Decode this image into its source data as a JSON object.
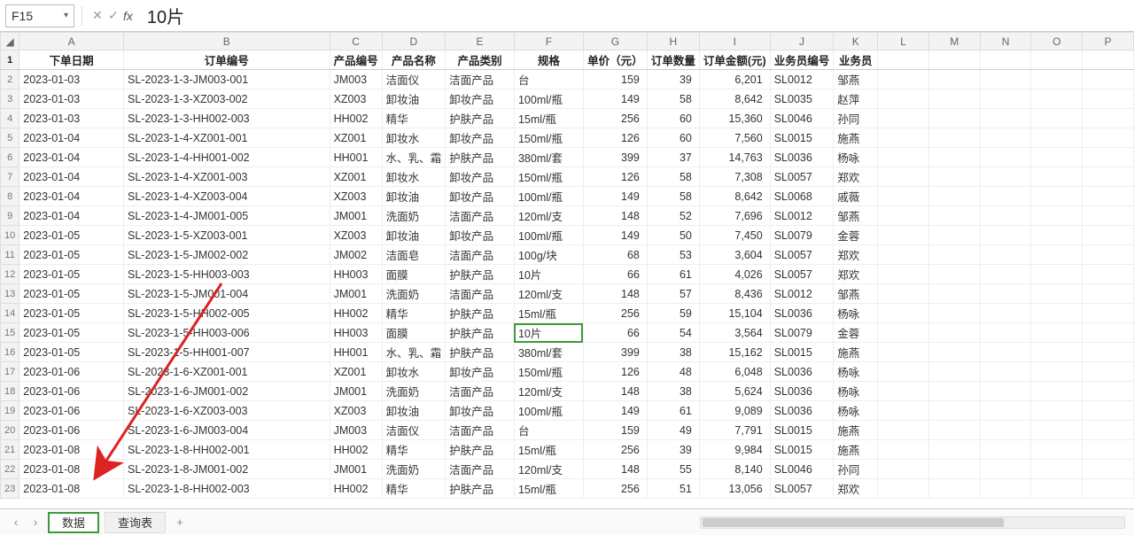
{
  "active_cell_ref": "F15",
  "formula_value": "10片",
  "col_letters": [
    "A",
    "B",
    "C",
    "D",
    "E",
    "F",
    "G",
    "H",
    "I",
    "J",
    "K",
    "L",
    "M",
    "N",
    "O",
    "P"
  ],
  "headers": {
    "c1": "下单日期",
    "c2": "订单编号",
    "c3": "产品编号",
    "c4": "产品名称",
    "c5": "产品类别",
    "c6": "规格",
    "c7": "单价（元）",
    "c8": "订单数量",
    "c9": "订单金额(元)",
    "c10": "业务员编号",
    "c11": "业务员"
  },
  "rows": [
    {
      "d": "2023-01-03",
      "ord": "SL-2023-1-3-JM003-001",
      "pid": "JM003",
      "pn": "洁面仪",
      "pc": "洁面产品",
      "sp": "台",
      "pr": "159",
      "qty": "39",
      "amt": "6,201",
      "sid": "SL0012",
      "sn": "邹燕"
    },
    {
      "d": "2023-01-03",
      "ord": "SL-2023-1-3-XZ003-002",
      "pid": "XZ003",
      "pn": "卸妆油",
      "pc": "卸妆产品",
      "sp": "100ml/瓶",
      "pr": "149",
      "qty": "58",
      "amt": "8,642",
      "sid": "SL0035",
      "sn": "赵萍"
    },
    {
      "d": "2023-01-03",
      "ord": "SL-2023-1-3-HH002-003",
      "pid": "HH002",
      "pn": "精华",
      "pc": "护肤产品",
      "sp": "15ml/瓶",
      "pr": "256",
      "qty": "60",
      "amt": "15,360",
      "sid": "SL0046",
      "sn": "孙同"
    },
    {
      "d": "2023-01-04",
      "ord": "SL-2023-1-4-XZ001-001",
      "pid": "XZ001",
      "pn": "卸妆水",
      "pc": "卸妆产品",
      "sp": "150ml/瓶",
      "pr": "126",
      "qty": "60",
      "amt": "7,560",
      "sid": "SL0015",
      "sn": "施燕"
    },
    {
      "d": "2023-01-04",
      "ord": "SL-2023-1-4-HH001-002",
      "pid": "HH001",
      "pn": "水、乳、霜",
      "pc": "护肤产品",
      "sp": "380ml/套",
      "pr": "399",
      "qty": "37",
      "amt": "14,763",
      "sid": "SL0036",
      "sn": "杨咏"
    },
    {
      "d": "2023-01-04",
      "ord": "SL-2023-1-4-XZ001-003",
      "pid": "XZ001",
      "pn": "卸妆水",
      "pc": "卸妆产品",
      "sp": "150ml/瓶",
      "pr": "126",
      "qty": "58",
      "amt": "7,308",
      "sid": "SL0057",
      "sn": "郑欢"
    },
    {
      "d": "2023-01-04",
      "ord": "SL-2023-1-4-XZ003-004",
      "pid": "XZ003",
      "pn": "卸妆油",
      "pc": "卸妆产品",
      "sp": "100ml/瓶",
      "pr": "149",
      "qty": "58",
      "amt": "8,642",
      "sid": "SL0068",
      "sn": "戚薇"
    },
    {
      "d": "2023-01-04",
      "ord": "SL-2023-1-4-JM001-005",
      "pid": "JM001",
      "pn": "洗面奶",
      "pc": "洁面产品",
      "sp": "120ml/支",
      "pr": "148",
      "qty": "52",
      "amt": "7,696",
      "sid": "SL0012",
      "sn": "邹燕"
    },
    {
      "d": "2023-01-05",
      "ord": "SL-2023-1-5-XZ003-001",
      "pid": "XZ003",
      "pn": "卸妆油",
      "pc": "卸妆产品",
      "sp": "100ml/瓶",
      "pr": "149",
      "qty": "50",
      "amt": "7,450",
      "sid": "SL0079",
      "sn": "金蓉"
    },
    {
      "d": "2023-01-05",
      "ord": "SL-2023-1-5-JM002-002",
      "pid": "JM002",
      "pn": "洁面皂",
      "pc": "洁面产品",
      "sp": "100g/块",
      "pr": "68",
      "qty": "53",
      "amt": "3,604",
      "sid": "SL0057",
      "sn": "郑欢"
    },
    {
      "d": "2023-01-05",
      "ord": "SL-2023-1-5-HH003-003",
      "pid": "HH003",
      "pn": "面膜",
      "pc": "护肤产品",
      "sp": "10片",
      "pr": "66",
      "qty": "61",
      "amt": "4,026",
      "sid": "SL0057",
      "sn": "郑欢"
    },
    {
      "d": "2023-01-05",
      "ord": "SL-2023-1-5-JM001-004",
      "pid": "JM001",
      "pn": "洗面奶",
      "pc": "洁面产品",
      "sp": "120ml/支",
      "pr": "148",
      "qty": "57",
      "amt": "8,436",
      "sid": "SL0012",
      "sn": "邹燕"
    },
    {
      "d": "2023-01-05",
      "ord": "SL-2023-1-5-HH002-005",
      "pid": "HH002",
      "pn": "精华",
      "pc": "护肤产品",
      "sp": "15ml/瓶",
      "pr": "256",
      "qty": "59",
      "amt": "15,104",
      "sid": "SL0036",
      "sn": "杨咏"
    },
    {
      "d": "2023-01-05",
      "ord": "SL-2023-1-5-HH003-006",
      "pid": "HH003",
      "pn": "面膜",
      "pc": "护肤产品",
      "sp": "10片",
      "pr": "66",
      "qty": "54",
      "amt": "3,564",
      "sid": "SL0079",
      "sn": "金蓉"
    },
    {
      "d": "2023-01-05",
      "ord": "SL-2023-1-5-HH001-007",
      "pid": "HH001",
      "pn": "水、乳、霜",
      "pc": "护肤产品",
      "sp": "380ml/套",
      "pr": "399",
      "qty": "38",
      "amt": "15,162",
      "sid": "SL0015",
      "sn": "施燕"
    },
    {
      "d": "2023-01-06",
      "ord": "SL-2023-1-6-XZ001-001",
      "pid": "XZ001",
      "pn": "卸妆水",
      "pc": "卸妆产品",
      "sp": "150ml/瓶",
      "pr": "126",
      "qty": "48",
      "amt": "6,048",
      "sid": "SL0036",
      "sn": "杨咏"
    },
    {
      "d": "2023-01-06",
      "ord": "SL-2023-1-6-JM001-002",
      "pid": "JM001",
      "pn": "洗面奶",
      "pc": "洁面产品",
      "sp": "120ml/支",
      "pr": "148",
      "qty": "38",
      "amt": "5,624",
      "sid": "SL0036",
      "sn": "杨咏"
    },
    {
      "d": "2023-01-06",
      "ord": "SL-2023-1-6-XZ003-003",
      "pid": "XZ003",
      "pn": "卸妆油",
      "pc": "卸妆产品",
      "sp": "100ml/瓶",
      "pr": "149",
      "qty": "61",
      "amt": "9,089",
      "sid": "SL0036",
      "sn": "杨咏"
    },
    {
      "d": "2023-01-06",
      "ord": "SL-2023-1-6-JM003-004",
      "pid": "JM003",
      "pn": "洁面仪",
      "pc": "洁面产品",
      "sp": "台",
      "pr": "159",
      "qty": "49",
      "amt": "7,791",
      "sid": "SL0015",
      "sn": "施燕"
    },
    {
      "d": "2023-01-08",
      "ord": "SL-2023-1-8-HH002-001",
      "pid": "HH002",
      "pn": "精华",
      "pc": "护肤产品",
      "sp": "15ml/瓶",
      "pr": "256",
      "qty": "39",
      "amt": "9,984",
      "sid": "SL0015",
      "sn": "施燕"
    },
    {
      "d": "2023-01-08",
      "ord": "SL-2023-1-8-JM001-002",
      "pid": "JM001",
      "pn": "洗面奶",
      "pc": "洁面产品",
      "sp": "120ml/支",
      "pr": "148",
      "qty": "55",
      "amt": "8,140",
      "sid": "SL0046",
      "sn": "孙同"
    },
    {
      "d": "2023-01-08",
      "ord": "SL-2023-1-8-HH002-003",
      "pid": "HH002",
      "pn": "精华",
      "pc": "护肤产品",
      "sp": "15ml/瓶",
      "pr": "256",
      "qty": "51",
      "amt": "13,056",
      "sid": "SL0057",
      "sn": "郑欢"
    }
  ],
  "sheet_tabs": {
    "active": "数据",
    "other": "查询表",
    "add": "+"
  },
  "active_row_index": 13
}
